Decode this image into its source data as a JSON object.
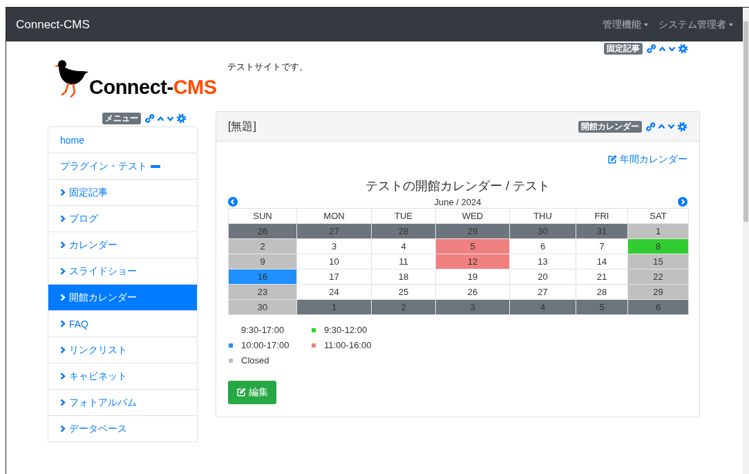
{
  "navbar": {
    "brand": "Connect-CMS",
    "menus": [
      {
        "label": "管理機能"
      },
      {
        "label": "システム管理者"
      }
    ]
  },
  "header": {
    "badge": "固定記事",
    "logo_dark": "Connect-",
    "logo_accent": "CMS",
    "site_text": "テストサイトです。"
  },
  "menu": {
    "badge": "メニュー",
    "items": [
      {
        "label": "home",
        "kind": "plain",
        "selected": false
      },
      {
        "label": "プラグイン・テスト",
        "kind": "group",
        "selected": false
      },
      {
        "label": "固定記事",
        "kind": "link",
        "selected": false
      },
      {
        "label": "ブログ",
        "kind": "link",
        "selected": false
      },
      {
        "label": "カレンダー",
        "kind": "link",
        "selected": false
      },
      {
        "label": "スライドショー",
        "kind": "link",
        "selected": false
      },
      {
        "label": "開館カレンダー",
        "kind": "link",
        "selected": true
      },
      {
        "label": "FAQ",
        "kind": "link",
        "selected": false
      },
      {
        "label": "リンクリスト",
        "kind": "link",
        "selected": false
      },
      {
        "label": "キャビネット",
        "kind": "link",
        "selected": false
      },
      {
        "label": "フォトアルバム",
        "kind": "link",
        "selected": false
      },
      {
        "label": "データベース",
        "kind": "link",
        "selected": false
      }
    ]
  },
  "calendar_frame": {
    "title": "[無題]",
    "badge": "開館カレンダー",
    "year_link": "年間カレンダー",
    "heading": "テストの開館カレンダー / テスト",
    "month": "June / 2024",
    "weekdays": [
      "SUN",
      "MON",
      "TUE",
      "WED",
      "THU",
      "FRI",
      "SAT"
    ],
    "weeks": [
      [
        {
          "day": "26",
          "color": "#6c757d"
        },
        {
          "day": "27",
          "color": "#6c757d"
        },
        {
          "day": "28",
          "color": "#6c757d"
        },
        {
          "day": "29",
          "color": "#6c757d"
        },
        {
          "day": "30",
          "color": "#6c757d"
        },
        {
          "day": "31",
          "color": "#6c757d"
        },
        {
          "day": "1",
          "color": "#c0c0c0"
        }
      ],
      [
        {
          "day": "2",
          "color": "#c0c0c0"
        },
        {
          "day": "3",
          "color": "#ffffff"
        },
        {
          "day": "4",
          "color": "#ffffff"
        },
        {
          "day": "5",
          "color": "#f08080"
        },
        {
          "day": "6",
          "color": "#ffffff"
        },
        {
          "day": "7",
          "color": "#ffffff"
        },
        {
          "day": "8",
          "color": "#32cd32"
        }
      ],
      [
        {
          "day": "9",
          "color": "#c0c0c0"
        },
        {
          "day": "10",
          "color": "#ffffff"
        },
        {
          "day": "11",
          "color": "#ffffff"
        },
        {
          "day": "12",
          "color": "#f08080"
        },
        {
          "day": "13",
          "color": "#ffffff"
        },
        {
          "day": "14",
          "color": "#ffffff"
        },
        {
          "day": "15",
          "color": "#c0c0c0"
        }
      ],
      [
        {
          "day": "16",
          "color": "#1e90ff"
        },
        {
          "day": "17",
          "color": "#ffffff"
        },
        {
          "day": "18",
          "color": "#ffffff"
        },
        {
          "day": "19",
          "color": "#ffffff"
        },
        {
          "day": "20",
          "color": "#ffffff"
        },
        {
          "day": "21",
          "color": "#ffffff"
        },
        {
          "day": "22",
          "color": "#c0c0c0"
        }
      ],
      [
        {
          "day": "23",
          "color": "#c0c0c0"
        },
        {
          "day": "24",
          "color": "#ffffff"
        },
        {
          "day": "25",
          "color": "#ffffff"
        },
        {
          "day": "26",
          "color": "#ffffff"
        },
        {
          "day": "27",
          "color": "#ffffff"
        },
        {
          "day": "28",
          "color": "#ffffff"
        },
        {
          "day": "29",
          "color": "#c0c0c0"
        }
      ],
      [
        {
          "day": "30",
          "color": "#c0c0c0"
        },
        {
          "day": "1",
          "color": "#6c757d"
        },
        {
          "day": "2",
          "color": "#6c757d"
        },
        {
          "day": "3",
          "color": "#6c757d"
        },
        {
          "day": "4",
          "color": "#6c757d"
        },
        {
          "day": "5",
          "color": "#6c757d"
        },
        {
          "day": "6",
          "color": "#6c757d"
        }
      ]
    ],
    "legend": [
      {
        "label": "9:30-17:00"
      },
      {
        "label": "9:30-12:00",
        "color": "#32cd32"
      },
      {
        "label": "10:00-17:00",
        "color": "#1e90ff"
      },
      {
        "label": "11:00-16:00",
        "color": "#f08080"
      },
      {
        "label": "Closed",
        "color": "#c0c0c0"
      }
    ],
    "edit_button": "編集"
  }
}
